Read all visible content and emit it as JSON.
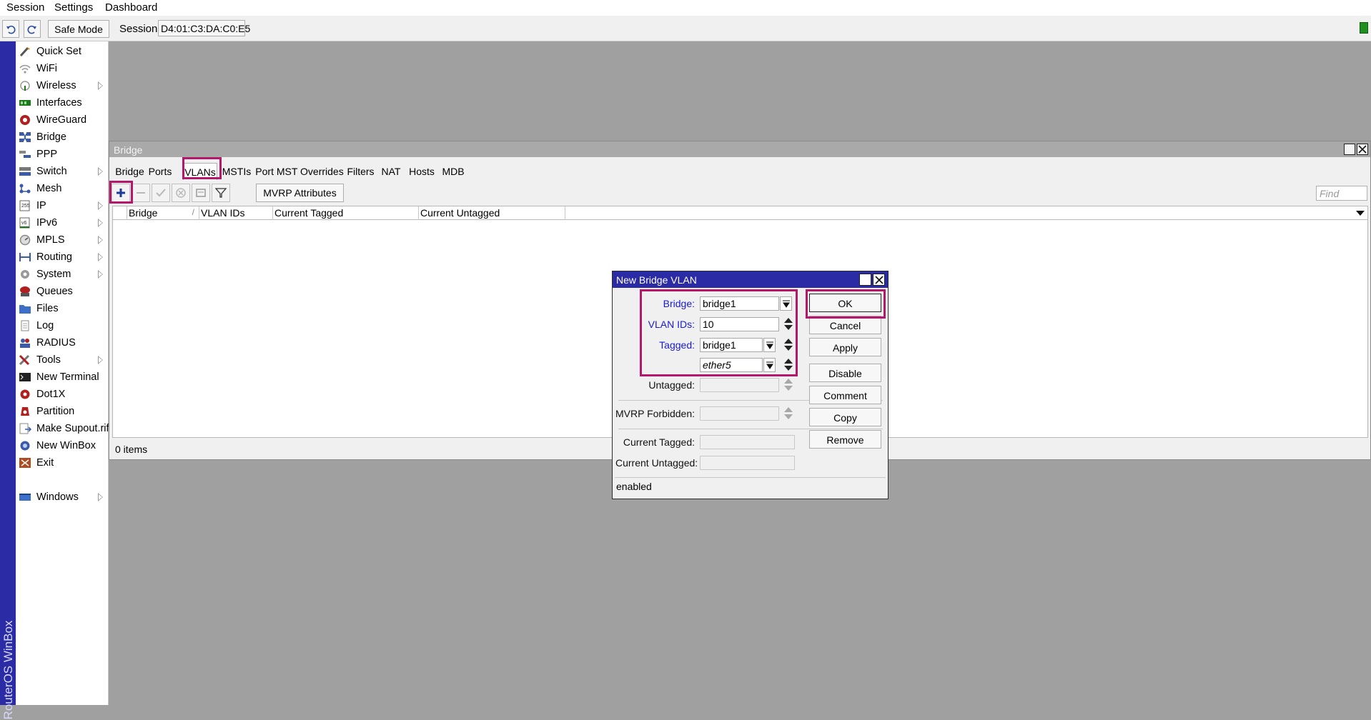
{
  "menubar": {
    "items": [
      "Session",
      "Settings",
      "Dashboard"
    ]
  },
  "toolbar": {
    "safe_mode": "Safe Mode",
    "session_label": "Session:",
    "session_value": "D4:01:C3:DA:C0:E5"
  },
  "brand": "RouterOS WinBox",
  "sidebar": {
    "items": [
      {
        "label": "Quick Set",
        "icon": "wand-icon"
      },
      {
        "label": "WiFi",
        "icon": "wifi-icon"
      },
      {
        "label": "Wireless",
        "icon": "wireless-icon",
        "submenu": true
      },
      {
        "label": "Interfaces",
        "icon": "interfaces-icon"
      },
      {
        "label": "WireGuard",
        "icon": "wireguard-icon"
      },
      {
        "label": "Bridge",
        "icon": "bridge-icon"
      },
      {
        "label": "PPP",
        "icon": "ppp-icon"
      },
      {
        "label": "Switch",
        "icon": "switch-icon",
        "submenu": true
      },
      {
        "label": "Mesh",
        "icon": "mesh-icon"
      },
      {
        "label": "IP",
        "icon": "ip-icon",
        "submenu": true
      },
      {
        "label": "IPv6",
        "icon": "ipv6-icon",
        "submenu": true
      },
      {
        "label": "MPLS",
        "icon": "mpls-icon",
        "submenu": true
      },
      {
        "label": "Routing",
        "icon": "routing-icon",
        "submenu": true
      },
      {
        "label": "System",
        "icon": "gear-icon",
        "submenu": true
      },
      {
        "label": "Queues",
        "icon": "queues-icon"
      },
      {
        "label": "Files",
        "icon": "folder-icon"
      },
      {
        "label": "Log",
        "icon": "log-icon"
      },
      {
        "label": "RADIUS",
        "icon": "radius-icon"
      },
      {
        "label": "Tools",
        "icon": "tools-icon",
        "submenu": true
      },
      {
        "label": "New Terminal",
        "icon": "terminal-icon"
      },
      {
        "label": "Dot1X",
        "icon": "dot1x-icon"
      },
      {
        "label": "Partition",
        "icon": "partition-icon"
      },
      {
        "label": "Make Supout.rif",
        "icon": "supout-icon"
      },
      {
        "label": "New WinBox",
        "icon": "winbox-icon"
      },
      {
        "label": "Exit",
        "icon": "exit-icon"
      }
    ],
    "windows": {
      "label": "Windows",
      "icon": "windows-icon",
      "submenu": true
    }
  },
  "bridge_window": {
    "title": "Bridge",
    "tabs": [
      "Bridge",
      "Ports",
      "VLANs",
      "MSTIs",
      "Port MST Overrides",
      "Filters",
      "NAT",
      "Hosts",
      "MDB"
    ],
    "active_tab": "VLANs",
    "mvrp_button": "MVRP Attributes",
    "find_placeholder": "Find",
    "columns": [
      "Bridge",
      "VLAN IDs",
      "Current Tagged",
      "Current Untagged"
    ],
    "sort_indicator": "/",
    "items_count": "0 items"
  },
  "dialog": {
    "title": "New Bridge VLAN",
    "fields": {
      "bridge_label": "Bridge:",
      "bridge_value": "bridge1",
      "vlan_ids_label": "VLAN IDs:",
      "vlan_ids_value": "10",
      "tagged_label": "Tagged:",
      "tagged_value_1": "bridge1",
      "tagged_value_2": "ether5",
      "untagged_label": "Untagged:",
      "untagged_value": "",
      "mvrp_forbidden_label": "MVRP Forbidden:",
      "mvrp_forbidden_value": "",
      "current_tagged_label": "Current Tagged:",
      "current_tagged_value": "",
      "current_untagged_label": "Current Untagged:",
      "current_untagged_value": ""
    },
    "buttons": [
      "OK",
      "Cancel",
      "Apply",
      "Disable",
      "Comment",
      "Copy",
      "Remove"
    ],
    "status": "enabled"
  },
  "colors": {
    "accent": "#2b2ba5",
    "highlight": "#b5176b",
    "label_blue": "#1a1ad6"
  }
}
